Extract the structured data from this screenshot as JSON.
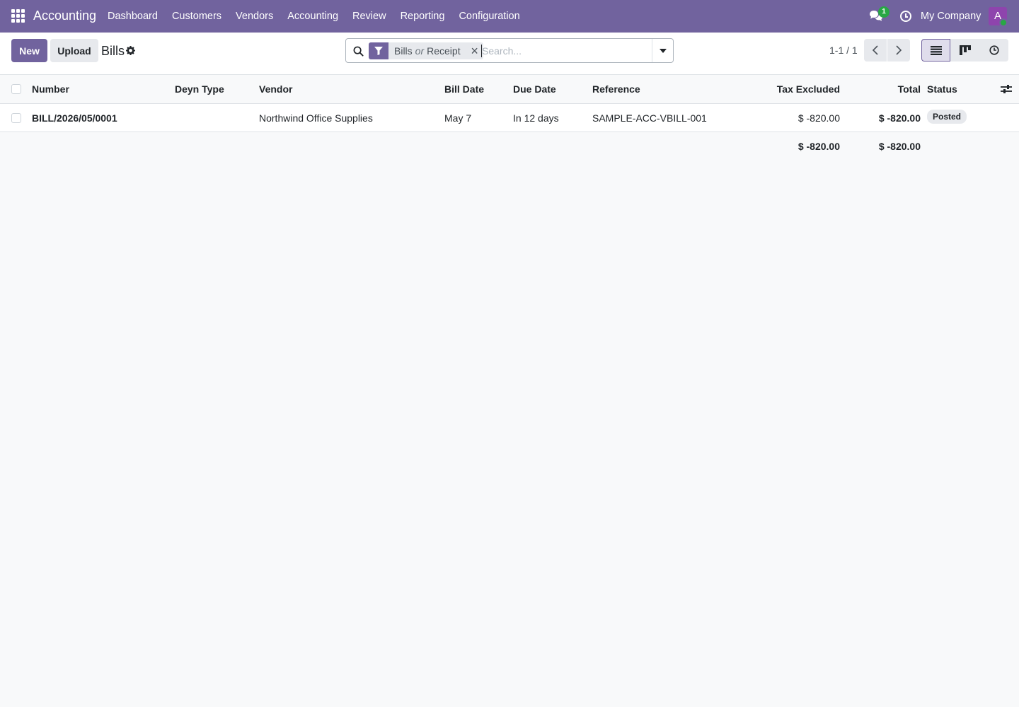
{
  "app": {
    "brand": "Accounting",
    "menu": [
      "Dashboard",
      "Customers",
      "Vendors",
      "Accounting",
      "Review",
      "Reporting",
      "Configuration"
    ],
    "chat_count": "1",
    "company": "My Company",
    "avatar_letter": "A"
  },
  "control_panel": {
    "new_label": "New",
    "upload_label": "Upload",
    "title": "Bills",
    "search": {
      "facet_values": [
        "Bills",
        "Receipt"
      ],
      "facet_separator": "or",
      "placeholder": "Search..."
    },
    "pager": "1-1 / 1"
  },
  "table": {
    "columns": {
      "number": "Number",
      "deyn_type": "Deyn Type",
      "vendor": "Vendor",
      "bill_date": "Bill Date",
      "due_date": "Due Date",
      "reference": "Reference",
      "tax_excluded": "Tax Excluded",
      "total": "Total",
      "status": "Status"
    },
    "rows": [
      {
        "number": "BILL/2026/05/0001",
        "deyn_type": "",
        "vendor": "Northwind Office Supplies",
        "bill_date": "May 7",
        "due_date": "In 12 days",
        "reference": "SAMPLE-ACC-VBILL-001",
        "tax_excluded": "$ -820.00",
        "total": "$ -820.00",
        "status": "Posted"
      }
    ],
    "totals": {
      "tax_excluded": "$ -820.00",
      "total": "$ -820.00"
    }
  },
  "colors": {
    "brand": "#71639e",
    "presence": "#28a745"
  }
}
